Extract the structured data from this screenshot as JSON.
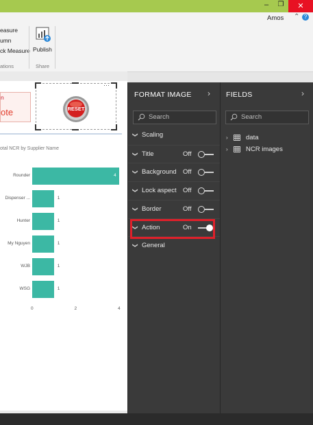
{
  "window": {
    "user_name": "Amos",
    "controls": [
      "–",
      "❐",
      "✕"
    ]
  },
  "ribbon": {
    "items_left": [
      "easure",
      "umn",
      "ck Measure"
    ],
    "group_left_label": "ations",
    "publish_label": "Publish",
    "share_label": "Share"
  },
  "canvas": {
    "card_text_top": "n",
    "card_text_big": "ote",
    "reset_label": "RESET",
    "more_label": "···"
  },
  "chart_data": {
    "type": "bar",
    "title": "otal NCR by Supplier Name",
    "categories": [
      "Rounder",
      "Dispenser ...",
      "Hunter",
      "My Nguyen",
      "WJB",
      "WSG"
    ],
    "values": [
      4,
      1,
      1,
      1,
      1,
      1
    ],
    "data_labels": [
      "4",
      "1",
      "1",
      "1",
      "1",
      "1"
    ],
    "xlim": [
      0,
      4
    ],
    "x_ticks": [
      "0",
      "2",
      "4"
    ],
    "orientation": "horizontal",
    "color": "#3cb8a4"
  },
  "format_pane": {
    "title": "FORMAT IMAGE",
    "search_placeholder": "Search",
    "cards": [
      {
        "label": "Scaling",
        "value": "",
        "toggle": "none"
      },
      {
        "label": "Title",
        "value": "Off",
        "toggle": "off"
      },
      {
        "label": "Background",
        "value": "Off",
        "toggle": "off"
      },
      {
        "label": "Lock aspect",
        "value": "Off",
        "toggle": "off"
      },
      {
        "label": "Border",
        "value": "Off",
        "toggle": "off"
      },
      {
        "label": "Action",
        "value": "On",
        "toggle": "on"
      },
      {
        "label": "General",
        "value": "",
        "toggle": "none"
      }
    ],
    "highlight_color": "#e0202a"
  },
  "fields_pane": {
    "title": "FIELDS",
    "search_placeholder": "Search",
    "tables": [
      {
        "label": "data"
      },
      {
        "label": "NCR images"
      }
    ]
  }
}
